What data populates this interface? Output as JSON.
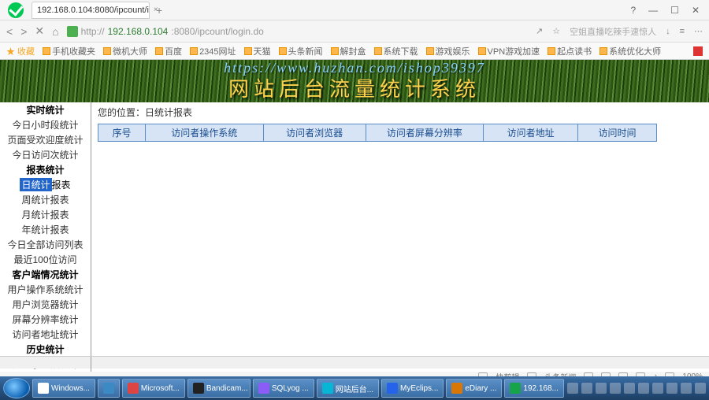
{
  "browser": {
    "tab_title": "192.168.0.104:8080/ipcount/i",
    "url_prefix": "http://",
    "url_host": "192.168.0.104",
    "url_path": ":8080/ipcount/login.do",
    "search_placeholder": "空姐直播吃辣手速惊人",
    "window_controls": {
      "help": "?",
      "min": "—",
      "max": "☐",
      "close": "✕"
    },
    "nav": {
      "back": "<",
      "fwd": ">",
      "close": "✕",
      "refresh": "⟳",
      "home": "⌂"
    },
    "addr_icons": {
      "share": "↗",
      "star": "☆",
      "dl": "↓",
      "menu": "≡",
      "more": "⋯"
    }
  },
  "bookmarks": {
    "fav_label": "★ 收藏",
    "items": [
      "手机收藏夹",
      "微机大师",
      "百度",
      "2345网址",
      "天猫",
      "头条新闻",
      "解封盒",
      "系统下载",
      "游戏娱乐",
      "VPN游戏加速",
      "起点读书",
      "系统优化大师"
    ]
  },
  "banner": {
    "url": "https://www.huzhan.com/ishop39397",
    "title": "网站后台流量统计系统"
  },
  "breadcrumb": "您的位置：日统计报表",
  "table_headers": [
    "序号",
    "访问者操作系统",
    "访问者浏览器",
    "访问者屏幕分辨率",
    "访问者地址",
    "访问时间"
  ],
  "sidebar": {
    "g1_title": "实时统计",
    "g1_items": [
      "今日小时段统计",
      "页面受欢迎度统计",
      "今日访问次统计"
    ],
    "g2_title": "报表统计",
    "g2_sel": "日统计",
    "g2_sel_suffix": "报表",
    "g2_items": [
      "周统计报表",
      "月统计报表",
      "年统计报表",
      "今日全部访问列表",
      "最近100位访问"
    ],
    "g3_title": "客户端情况统计",
    "g3_items": [
      "用户操作系统统计",
      "用户浏览器统计",
      "屏幕分辨率统计",
      "访问者地址统计"
    ],
    "g4_title": "历史统计",
    "g4_items": [
      "历史小时段统计"
    ]
  },
  "statusbar": {
    "items": [
      "快剪辑",
      "头条新闻"
    ],
    "sound": "♪",
    "zoom": "100%"
  },
  "taskbar": {
    "items": [
      "Windows...",
      "",
      "Microsoft...",
      "Bandicam...",
      "SQLyog ...",
      "网站后台...",
      "MyEclips...",
      "eDiary ...",
      "192.168..."
    ],
    "time": "",
    "icons_count": 12
  }
}
